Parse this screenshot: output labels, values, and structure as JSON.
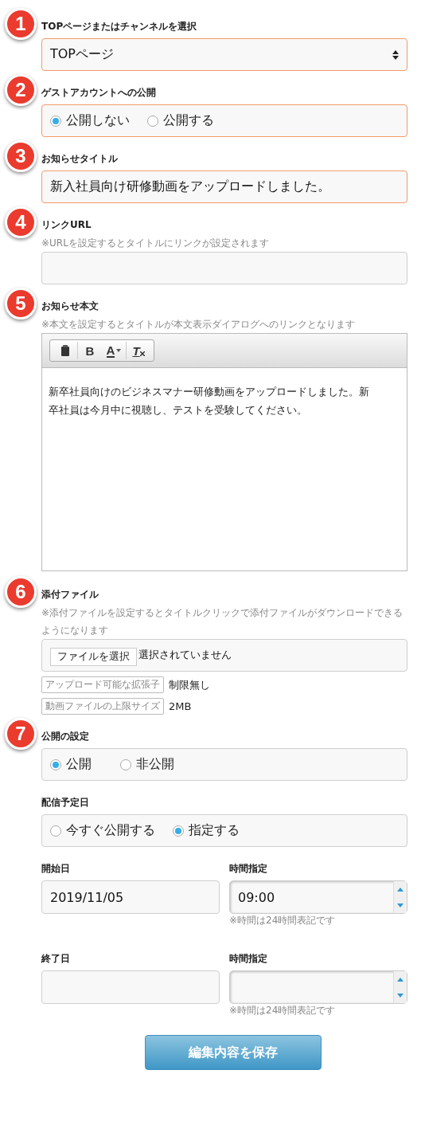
{
  "sections": [
    {
      "badge": "1",
      "label": "TOPページまたはチャンネルを選択",
      "highlighted": true,
      "kind": "select",
      "value": "TOPページ"
    },
    {
      "badge": "2",
      "label": "ゲストアカウントへの公開",
      "highlighted": true,
      "kind": "radio",
      "options": [
        {
          "label": "公開しない",
          "selected": true
        },
        {
          "label": "公開する",
          "selected": false
        }
      ]
    },
    {
      "badge": "3",
      "label": "お知らせタイトル",
      "highlighted": true,
      "kind": "text",
      "value": "新入社員向け研修動画をアップロードしました。"
    },
    {
      "badge": "4",
      "label": "リンクURL",
      "note": "※URLを設定するとタイトルにリンクが設定されます",
      "highlighted": false,
      "kind": "text"
    },
    {
      "badge": "5",
      "label": "お知らせ本文",
      "note": "※本文を設定するとタイトルが本文表示ダイアログへのリンクとなります",
      "kind": "editor",
      "toolbar": [
        {
          "kind": "paste"
        },
        {
          "kind": "bold",
          "label": "B"
        },
        {
          "kind": "color",
          "label": "A"
        },
        {
          "kind": "clear",
          "label": "T"
        }
      ],
      "value": "新卒社員向けのビジネスマナー研修動画をアップロードしました。新卒社員は今月中に視聴し、テストを受験してください。"
    },
    {
      "badge": "6",
      "label": "添付ファイル",
      "note": "※添付ファイルを設定するとタイトルクリックで添付ファイルがダウンロードできるようになります",
      "kind": "file",
      "button": "ファイルを選択",
      "status": "選択されていません",
      "info": [
        {
          "label": "アップロード可能な拡張子",
          "value": "制限無し"
        },
        {
          "label": "動画ファイルの上限サイズ",
          "value": "2MB"
        }
      ]
    },
    {
      "badge": "7",
      "label": "公開の設定",
      "highlighted": false,
      "kind": "radio",
      "wide": true,
      "options": [
        {
          "label": "公開",
          "selected": true
        },
        {
          "label": "非公開",
          "selected": false
        }
      ]
    },
    {
      "label": "配信予定日",
      "highlighted": false,
      "kind": "radio",
      "options": [
        {
          "label": "今すぐ公開する",
          "selected": false
        },
        {
          "label": "指定する",
          "selected": true
        }
      ]
    },
    {
      "kind": "dates",
      "rows": [
        [
          {
            "label": "開始日",
            "kind": "date",
            "value": "2019/11/05"
          },
          {
            "label": "時間指定",
            "kind": "time",
            "value": "09:00",
            "note": "※時間は24時間表記です"
          }
        ],
        [
          {
            "label": "終了日",
            "kind": "date"
          },
          {
            "label": "時間指定",
            "kind": "time",
            "note": "※時間は24時間表記です"
          }
        ]
      ]
    }
  ],
  "save_button": "編集内容を保存"
}
